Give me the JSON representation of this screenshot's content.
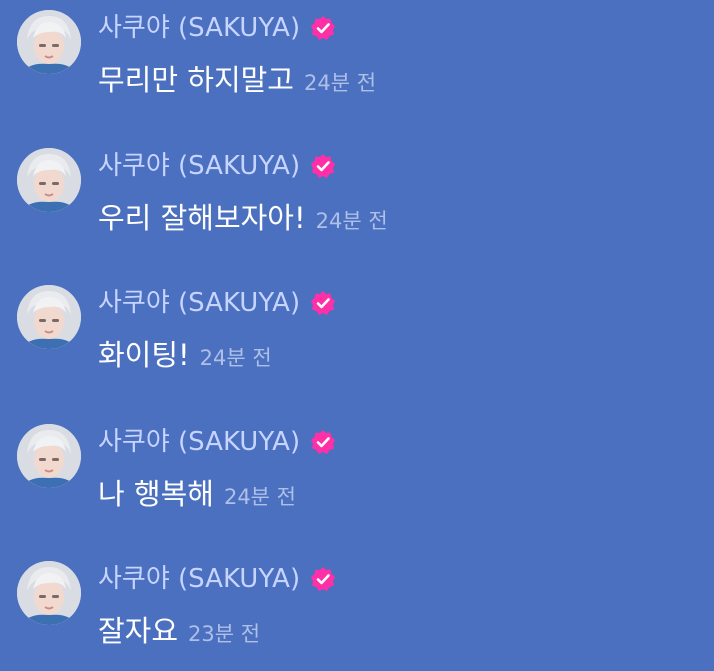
{
  "theme": {
    "background": "#4b70bf",
    "name_color": "#c6d4ff",
    "text_color": "#ffffff",
    "time_color": "#aebfe8",
    "verified_color": "#ff2fa8"
  },
  "messages": [
    {
      "sender": "사쿠야 (SAKUYA)",
      "verified_icon": "verified-check-icon",
      "text": "무리만 하지말고",
      "time": "24분 전"
    },
    {
      "sender": "사쿠야 (SAKUYA)",
      "verified_icon": "verified-check-icon",
      "text": "우리 잘해보자아!",
      "time": "24분 전"
    },
    {
      "sender": "사쿠야 (SAKUYA)",
      "verified_icon": "verified-check-icon",
      "text": "화이팅!",
      "time": "24분 전"
    },
    {
      "sender": "사쿠야 (SAKUYA)",
      "verified_icon": "verified-check-icon",
      "text": "나 행복해",
      "time": "24분 전"
    },
    {
      "sender": "사쿠야 (SAKUYA)",
      "verified_icon": "verified-check-icon",
      "text": "잘자요",
      "time": "23분 전"
    }
  ]
}
